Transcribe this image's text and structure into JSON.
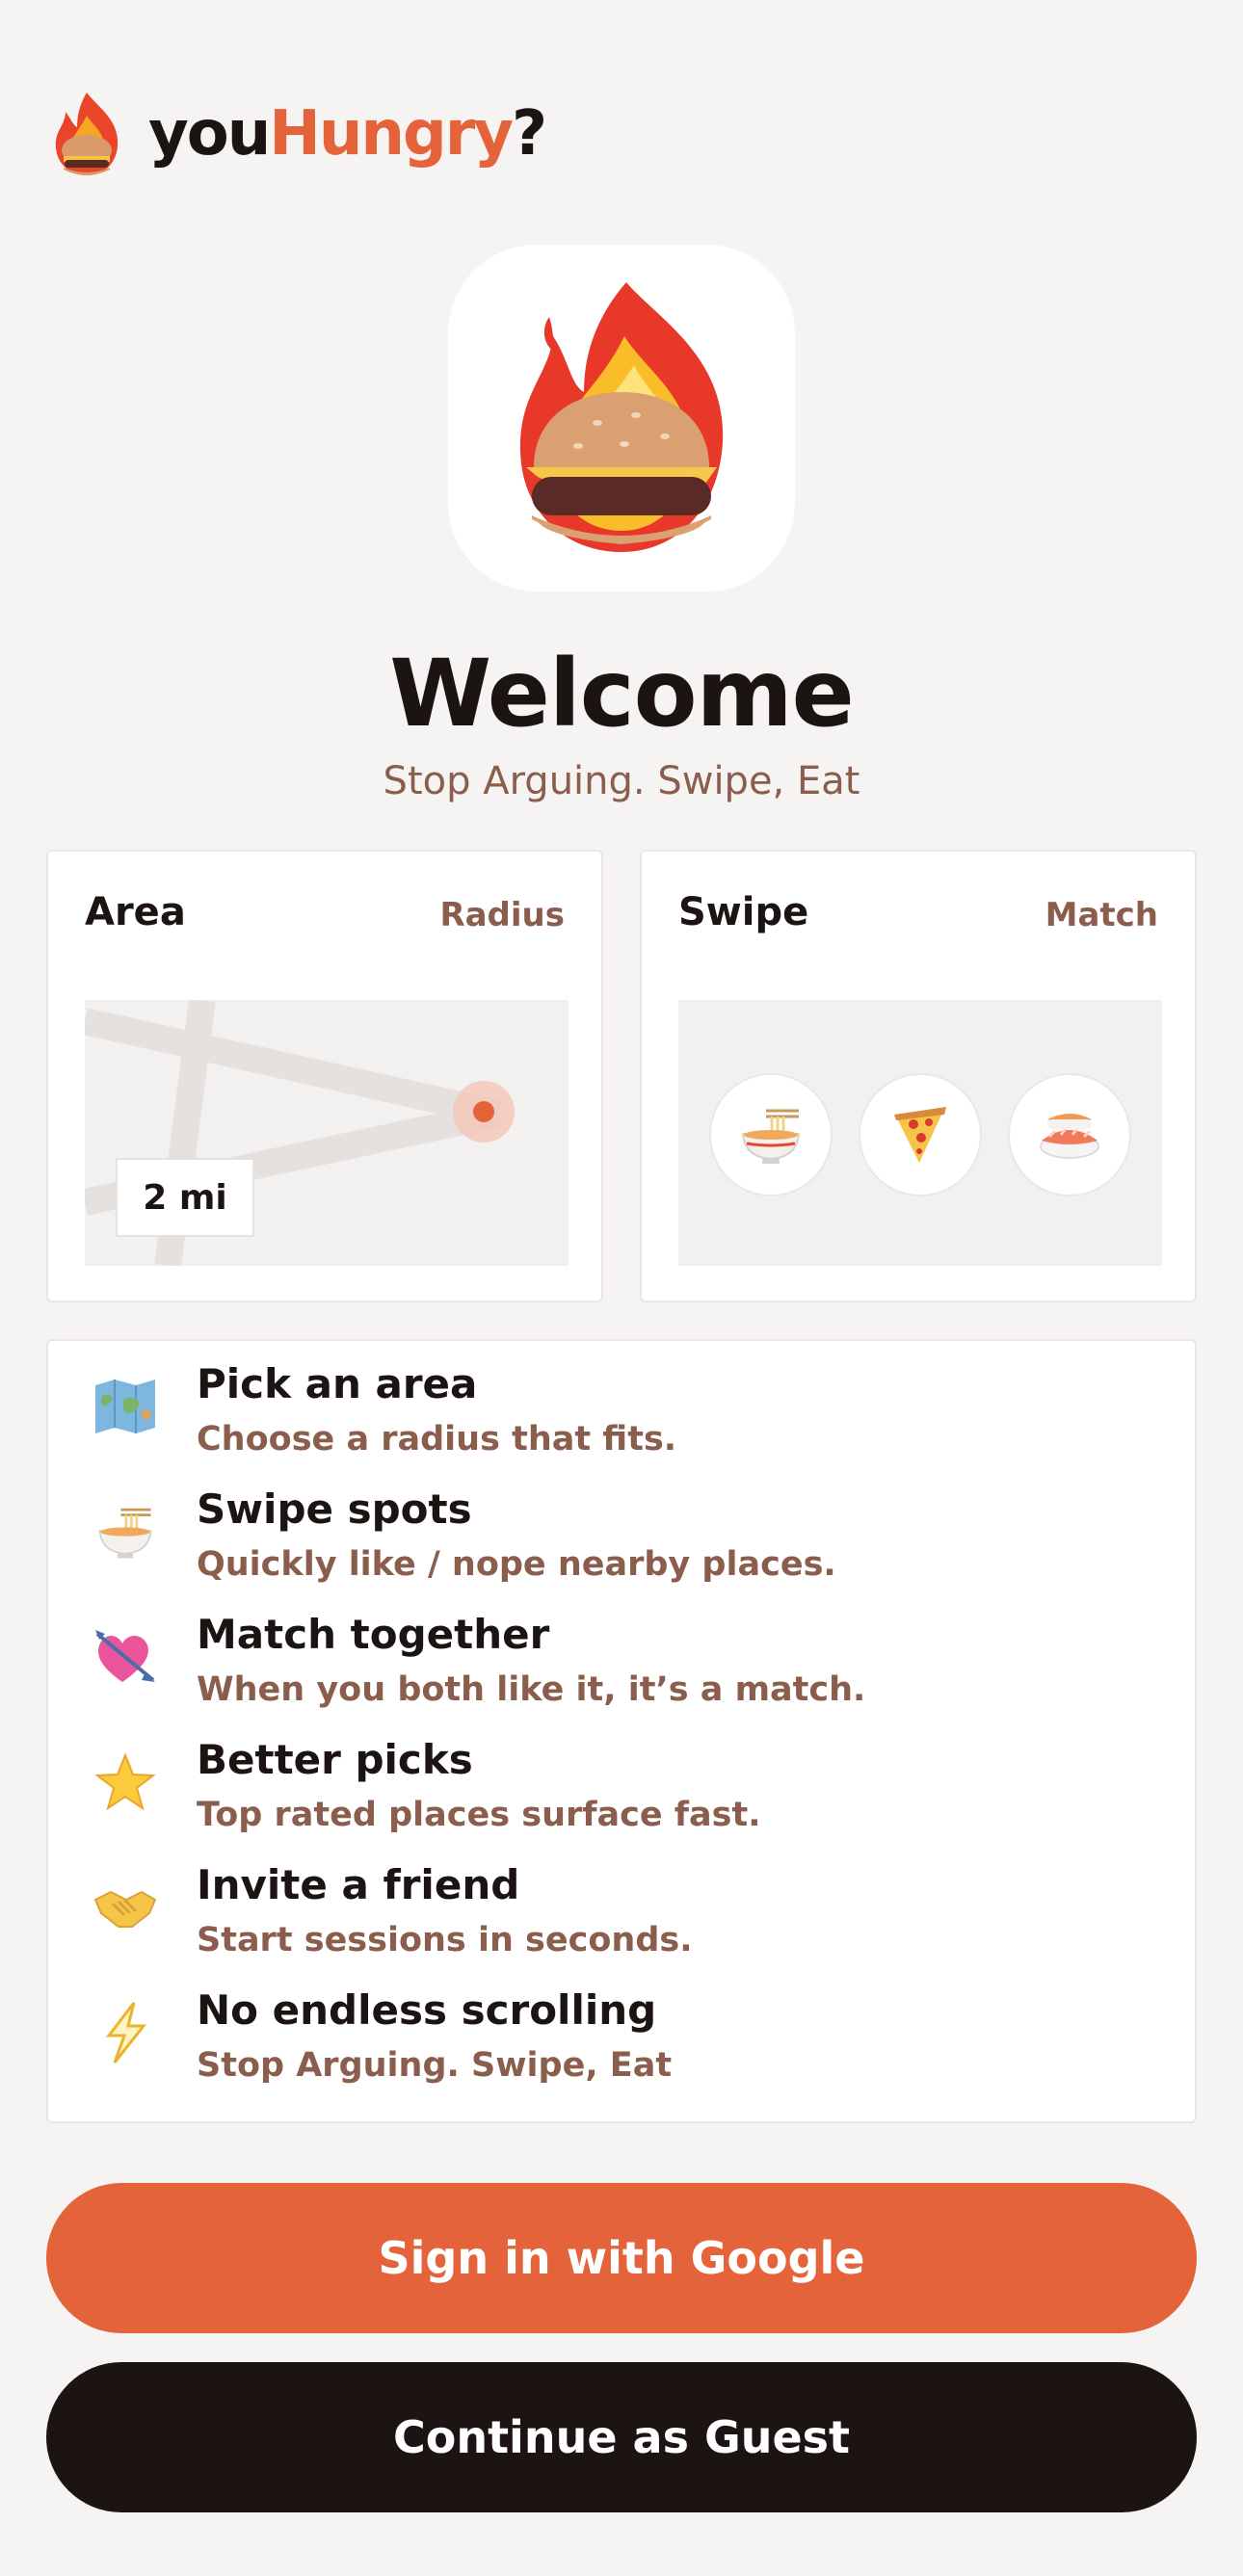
{
  "header": {
    "brand_you": "you",
    "brand_hungry": "Hungry",
    "brand_q": "?"
  },
  "hero": {
    "title": "Welcome",
    "tagline": "Stop Arguing. Swipe, Eat"
  },
  "cards": {
    "area": {
      "title": "Area",
      "tag": "Radius",
      "radius_label": "2 mi"
    },
    "swipe": {
      "title": "Swipe",
      "tag": "Match",
      "foods": [
        "ramen-icon",
        "pizza-icon",
        "sushi-icon"
      ]
    }
  },
  "steps": [
    {
      "icon": "map-icon",
      "title": "Pick an area",
      "subtitle": "Choose a radius that fits."
    },
    {
      "icon": "ramen-bowl-icon",
      "title": "Swipe spots",
      "subtitle": "Quickly like / nope nearby places."
    },
    {
      "icon": "heart-arrow-icon",
      "title": "Match together",
      "subtitle": "When you both like it, it’s a match."
    },
    {
      "icon": "star-icon",
      "title": "Better picks",
      "subtitle": "Top rated places surface fast."
    },
    {
      "icon": "handshake-icon",
      "title": "Invite a friend",
      "subtitle": "Start sessions in seconds."
    },
    {
      "icon": "lightning-icon",
      "title": "No endless scrolling",
      "subtitle": "Stop Arguing. Swipe, Eat"
    }
  ],
  "buttons": {
    "google": "Sign in with Google",
    "guest": "Continue as Guest"
  },
  "colors": {
    "accent": "#e5633a",
    "dark": "#1c1412",
    "muted": "#8a5d4d",
    "background": "#f6f4f3"
  }
}
